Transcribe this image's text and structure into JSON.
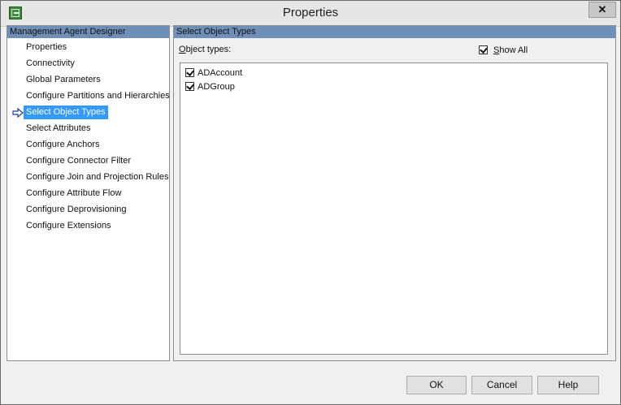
{
  "window": {
    "title": "Properties"
  },
  "left_panel": {
    "header": "Management Agent Designer",
    "items": [
      {
        "label": "Properties"
      },
      {
        "label": "Connectivity"
      },
      {
        "label": "Global Parameters"
      },
      {
        "label": "Configure Partitions and Hierarchies"
      },
      {
        "label": "Select Object Types",
        "selected": true
      },
      {
        "label": "Select Attributes"
      },
      {
        "label": "Configure Anchors"
      },
      {
        "label": "Configure Connector Filter"
      },
      {
        "label": "Configure Join and Projection Rules"
      },
      {
        "label": "Configure Attribute Flow"
      },
      {
        "label": "Configure Deprovisioning"
      },
      {
        "label": "Configure Extensions"
      }
    ]
  },
  "right_panel": {
    "header": "Select Object Types",
    "object_types_label": "Object types:",
    "show_all_label": "Show All",
    "show_all_checked": true,
    "object_types": [
      {
        "label": "ADAccount",
        "checked": true
      },
      {
        "label": "ADGroup",
        "checked": true
      }
    ]
  },
  "buttons": {
    "ok": "OK",
    "cancel": "Cancel",
    "help": "Help"
  },
  "colors": {
    "header_bg": "#6e8fb8",
    "selection_bg": "#3399ff",
    "window_bg": "#f0f0f0"
  }
}
